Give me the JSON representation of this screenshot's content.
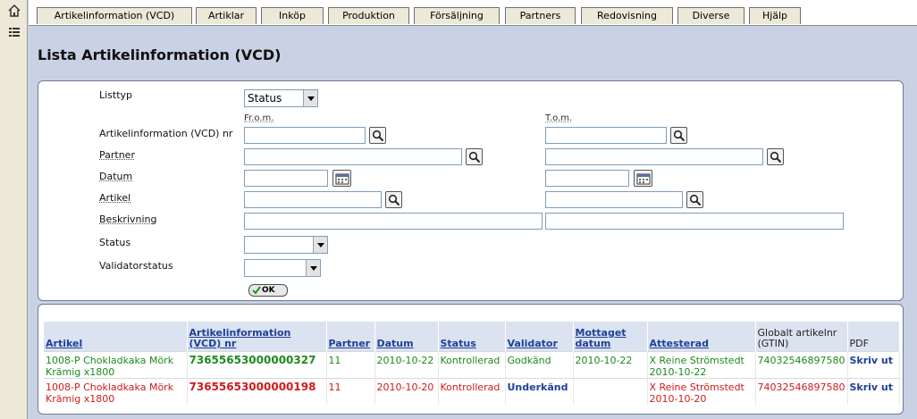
{
  "tabs": [
    {
      "label": "Artikelinformation (VCD)"
    },
    {
      "label": "Artiklar"
    },
    {
      "label": "Inköp"
    },
    {
      "label": "Produktion"
    },
    {
      "label": "Försäljning"
    },
    {
      "label": "Partners"
    },
    {
      "label": "Redovisning"
    },
    {
      "label": "Diverse"
    },
    {
      "label": "Hjälp"
    }
  ],
  "page": {
    "title": "Lista Artikelinformation (VCD)"
  },
  "filter": {
    "listtyp_label": "Listtyp",
    "listtyp_value": "Status",
    "from_label": "Fr.o.m.",
    "to_label": "T.o.m.",
    "vcd_nr_label": "Artikelinformation (VCD) nr",
    "partner_label": "Partner",
    "datum_label": "Datum",
    "artikel_label": "Artikel",
    "beskrivning_label": "Beskrivning",
    "status_label": "Status",
    "validatorstatus_label": "Validatorstatus",
    "ok_label": "OK"
  },
  "table": {
    "headers": {
      "artikel": "Artikel",
      "vcd_nr": "Artikelinformation (VCD) nr",
      "partner": "Partner",
      "datum": "Datum",
      "status": "Status",
      "validator": "Validator",
      "mottaget": "Mottaget datum",
      "attesterad": "Attesterad",
      "gtin": "Globalt artikelnr (GTIN)",
      "pdf": "PDF"
    },
    "rows": [
      {
        "artikel": "1008-P  Chokladkaka Mörk Krämig x1800",
        "vcd_nr": "73655653000000327",
        "partner": "11",
        "datum": "2010-10-22",
        "status": "Kontrollerad",
        "validator": "Godkänd",
        "mottaget": "2010-10-22",
        "attesterad": "X Reine Strömstedt 2010-10-22",
        "gtin": "74032546897580",
        "pdf": "Skriv ut",
        "row_color": "#1d8a1d"
      },
      {
        "artikel": "1008-P  Chokladkaka Mörk Krämig x1800",
        "vcd_nr": "73655653000000198",
        "partner": "11",
        "datum": "2010-10-20",
        "status": "Kontrollerad",
        "validator": "Underkänd",
        "mottaget": "",
        "attesterad": "X Reine Strömstedt 2010-10-20",
        "gtin": "74032546897580",
        "pdf": "Skriv ut",
        "row_color": "#d11a1a"
      }
    ]
  },
  "colors": {
    "background": "#c9d2e4",
    "header_row": "#dbe3f0",
    "link": "#1f3f9a",
    "approved": "#1d8a1d",
    "rejected": "#d11a1a"
  },
  "icons": {
    "left_top": "home-icon",
    "left_second": "menu-list-icon",
    "lookup": "magnifier-icon",
    "date": "calendar-icon"
  }
}
